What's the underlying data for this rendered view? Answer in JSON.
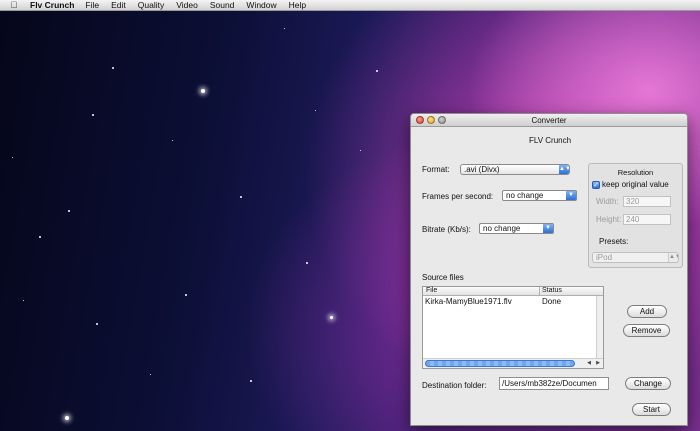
{
  "menubar": {
    "apple_icon": "apple-icon",
    "app_name": "Flv Crunch",
    "items": [
      "File",
      "Edit",
      "Quality",
      "Video",
      "Sound",
      "Window",
      "Help"
    ]
  },
  "window": {
    "title": "Converter",
    "heading": "FLV Crunch",
    "format": {
      "label": "Format:",
      "value": ".avi (Divx)"
    },
    "fps": {
      "label": "Frames per second:",
      "value": "no change"
    },
    "bitrate": {
      "label": "Bitrate (Kb/s):",
      "value": "no change"
    },
    "resolution": {
      "title": "Resolution",
      "keep_original": {
        "label": "keep original value",
        "checked": true
      },
      "width": {
        "label": "Width:",
        "value": "320"
      },
      "height": {
        "label": "Height:",
        "value": "240"
      },
      "presets": {
        "label": "Presets:",
        "value": "iPod"
      }
    },
    "source_files": {
      "label": "Source files",
      "columns": [
        "File",
        "Status"
      ],
      "rows": [
        {
          "file": "Kirka-MamyBlue1971.flv",
          "status": "Done"
        }
      ]
    },
    "add_label": "Add",
    "remove_label": "Remove",
    "destination": {
      "label": "Destination folder:",
      "value": "/Users/mb382ze/Documen"
    },
    "change_label": "Change",
    "start_label": "Start"
  },
  "colors": {
    "accent": "#2c6fd8"
  }
}
